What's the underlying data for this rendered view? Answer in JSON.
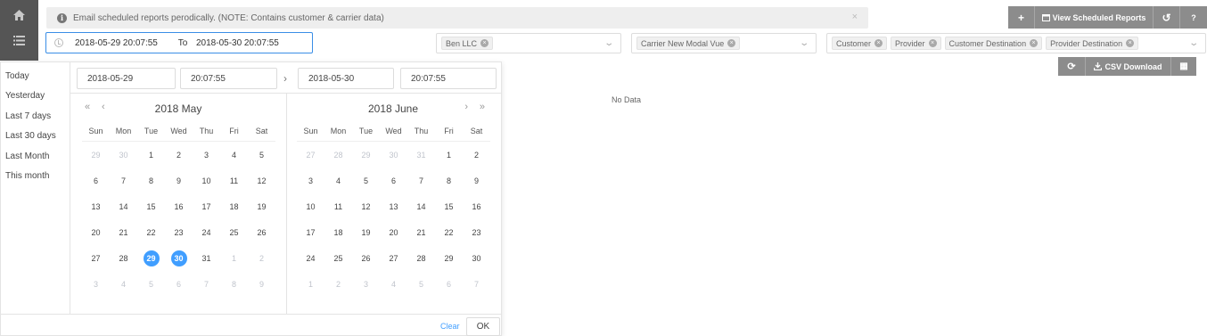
{
  "rail": {
    "home_icon": "home-icon",
    "list_icon": "list-icon"
  },
  "notice": {
    "text": "Email scheduled reports perodically. (NOTE: Contains customer & carrier data)",
    "close": "×"
  },
  "toolbar": {
    "add_label": "+",
    "view_reports_label": "View Scheduled Reports",
    "refresh_label": "↺",
    "help_label": "?"
  },
  "daterange": {
    "start": "2018-05-29 20:07:55",
    "separator": "To",
    "end": "2018-05-30 20:07:55"
  },
  "filters": {
    "company": [
      "Ben LLC"
    ],
    "carrier": [
      "Carrier New Modal Vue"
    ],
    "group_by": [
      "Customer",
      "Provider",
      "Customer Destination",
      "Provider Destination"
    ]
  },
  "toolbar2": {
    "refresh_label": "⟳",
    "csv_label": "CSV Download",
    "calc_label": "▦"
  },
  "main": {
    "no_data": "No Data"
  },
  "picker": {
    "shortcuts": [
      "Today",
      "Yesterday",
      "Last 7 days",
      "Last 30 days",
      "Last Month",
      "This month"
    ],
    "start_date": "2018-05-29",
    "start_time": "20:07:55",
    "end_date": "2018-05-30",
    "end_time": "20:07:55",
    "weekdays": [
      "Sun",
      "Mon",
      "Tue",
      "Wed",
      "Thu",
      "Fri",
      "Sat"
    ],
    "left": {
      "title": "2018 May",
      "days": [
        [
          "29",
          "m"
        ],
        [
          "30",
          "m"
        ],
        [
          "1",
          ""
        ],
        [
          "2",
          ""
        ],
        [
          "3",
          ""
        ],
        [
          "4",
          ""
        ],
        [
          "5",
          ""
        ],
        [
          "6",
          ""
        ],
        [
          "7",
          ""
        ],
        [
          "8",
          ""
        ],
        [
          "9",
          ""
        ],
        [
          "10",
          ""
        ],
        [
          "11",
          ""
        ],
        [
          "12",
          ""
        ],
        [
          "13",
          ""
        ],
        [
          "14",
          ""
        ],
        [
          "15",
          ""
        ],
        [
          "16",
          ""
        ],
        [
          "17",
          ""
        ],
        [
          "18",
          ""
        ],
        [
          "19",
          ""
        ],
        [
          "20",
          ""
        ],
        [
          "21",
          ""
        ],
        [
          "22",
          ""
        ],
        [
          "23",
          ""
        ],
        [
          "24",
          ""
        ],
        [
          "25",
          ""
        ],
        [
          "26",
          ""
        ],
        [
          "27",
          ""
        ],
        [
          "28",
          ""
        ],
        [
          "29",
          "s"
        ],
        [
          "30",
          "s"
        ],
        [
          "31",
          ""
        ],
        [
          "1",
          "m"
        ],
        [
          "2",
          "m"
        ],
        [
          "3",
          "m"
        ],
        [
          "4",
          "m"
        ],
        [
          "5",
          "m"
        ],
        [
          "6",
          "m"
        ],
        [
          "7",
          "m"
        ],
        [
          "8",
          "m"
        ],
        [
          "9",
          "m"
        ]
      ]
    },
    "right": {
      "title": "2018 June",
      "days": [
        [
          "27",
          "m"
        ],
        [
          "28",
          "m"
        ],
        [
          "29",
          "m"
        ],
        [
          "30",
          "m"
        ],
        [
          "31",
          "m"
        ],
        [
          "1",
          ""
        ],
        [
          "2",
          ""
        ],
        [
          "3",
          ""
        ],
        [
          "4",
          ""
        ],
        [
          "5",
          ""
        ],
        [
          "6",
          ""
        ],
        [
          "7",
          ""
        ],
        [
          "8",
          ""
        ],
        [
          "9",
          ""
        ],
        [
          "10",
          ""
        ],
        [
          "11",
          ""
        ],
        [
          "12",
          ""
        ],
        [
          "13",
          ""
        ],
        [
          "14",
          ""
        ],
        [
          "15",
          ""
        ],
        [
          "16",
          ""
        ],
        [
          "17",
          ""
        ],
        [
          "18",
          ""
        ],
        [
          "19",
          ""
        ],
        [
          "20",
          ""
        ],
        [
          "21",
          ""
        ],
        [
          "22",
          ""
        ],
        [
          "23",
          ""
        ],
        [
          "24",
          ""
        ],
        [
          "25",
          ""
        ],
        [
          "26",
          ""
        ],
        [
          "27",
          ""
        ],
        [
          "28",
          ""
        ],
        [
          "29",
          ""
        ],
        [
          "30",
          ""
        ],
        [
          "1",
          "m"
        ],
        [
          "2",
          "m"
        ],
        [
          "3",
          "m"
        ],
        [
          "4",
          "m"
        ],
        [
          "5",
          "m"
        ],
        [
          "6",
          "m"
        ],
        [
          "7",
          "m"
        ]
      ]
    },
    "clear_label": "Clear",
    "ok_label": "OK",
    "accent": "#409eff"
  }
}
